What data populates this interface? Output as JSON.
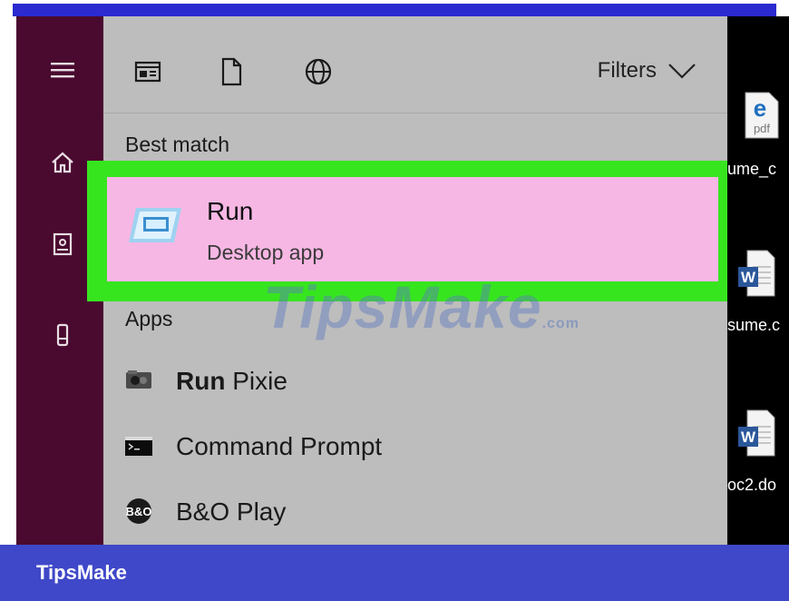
{
  "toolbar": {
    "filters_label": "Filters"
  },
  "sections": {
    "best_match": "Best match",
    "apps": "Apps"
  },
  "best_match": {
    "title": "Run",
    "subtitle": "Desktop app"
  },
  "apps": [
    {
      "bold": "Run",
      "rest": " Pixie",
      "icon": "run-pixie-icon"
    },
    {
      "bold": "",
      "rest": "Command Prompt",
      "icon": "command-prompt-icon"
    },
    {
      "bold": "",
      "rest": "B&O Play",
      "icon": "bo-play-icon"
    }
  ],
  "desktop": {
    "files": [
      {
        "label": "ume_c",
        "icon": "pdf-file-icon",
        "badge": "pdf"
      },
      {
        "label": "sume.c",
        "icon": "word-file-icon",
        "badge": "W"
      },
      {
        "label": "oc2.do",
        "icon": "word-file-icon",
        "badge": "W"
      }
    ]
  },
  "watermark": {
    "text": "TipsMake",
    "suffix": ".com"
  },
  "footer": {
    "brand": "TipsMake"
  },
  "colors": {
    "rail": "#4a0a30",
    "panel": "#bdbdbd",
    "highlight": "#37e51f",
    "card": "#f7b7e4",
    "footer": "#3f48c8"
  }
}
